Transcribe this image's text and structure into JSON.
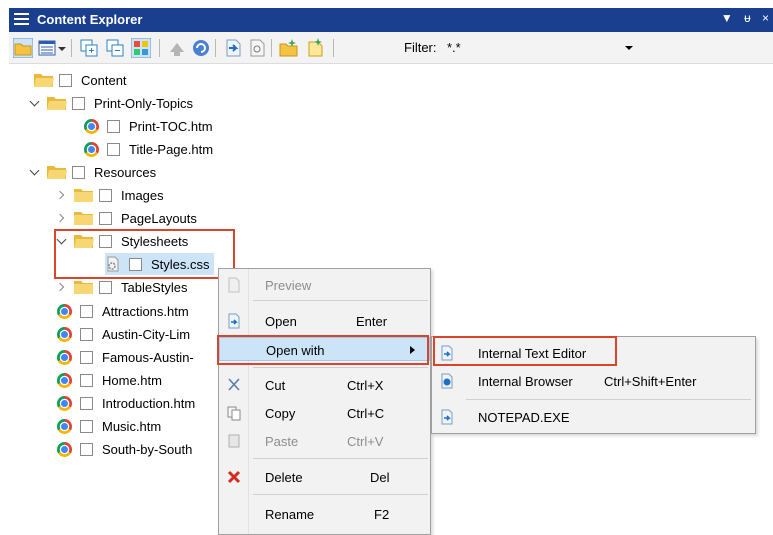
{
  "window": {
    "title": "Content Explorer",
    "title_buttons": [
      "▼",
      "ᵾ",
      "×"
    ],
    "colors": {
      "titlebar": "#1b3f8f",
      "highlight_box": "#d9442a",
      "menu_active": "#cce4f7"
    }
  },
  "toolbar": {
    "filter_label": "Filter:",
    "filter_value": "*.*"
  },
  "tree": [
    {
      "label": "Content",
      "icon": "folder-open-icon",
      "level": 0,
      "chevron": "none"
    },
    {
      "label": "Print-Only-Topics",
      "icon": "folder-open-icon",
      "level": 1,
      "chevron": "down"
    },
    {
      "label": "Print-TOC.htm",
      "icon": "chrome-icon",
      "level": 2,
      "chevron": "none"
    },
    {
      "label": "Title-Page.htm",
      "icon": "chrome-icon",
      "level": 2,
      "chevron": "none"
    },
    {
      "label": "Resources",
      "icon": "folder-open-icon",
      "level": 1,
      "chevron": "down"
    },
    {
      "label": "Images",
      "icon": "folder-icon",
      "level": 2,
      "chevron": "right"
    },
    {
      "label": "PageLayouts",
      "icon": "folder-icon",
      "level": 2,
      "chevron": "right"
    },
    {
      "label": "Stylesheets",
      "icon": "folder-open-icon",
      "level": 2,
      "chevron": "down"
    },
    {
      "label": "Styles.css",
      "icon": "css-file-icon",
      "level": 3,
      "chevron": "none"
    },
    {
      "label": "TableStyles",
      "icon": "folder-icon",
      "level": 2,
      "chevron": "right"
    },
    {
      "label": "Attractions.htm",
      "icon": "chrome-icon",
      "level": 1,
      "chevron": "none"
    },
    {
      "label": "Austin-City-Lim",
      "icon": "chrome-icon",
      "level": 1,
      "chevron": "none"
    },
    {
      "label": "Famous-Austin-",
      "icon": "chrome-icon",
      "level": 1,
      "chevron": "none"
    },
    {
      "label": "Home.htm",
      "icon": "chrome-icon",
      "level": 1,
      "chevron": "none"
    },
    {
      "label": "Introduction.htm",
      "icon": "chrome-icon",
      "level": 1,
      "chevron": "none"
    },
    {
      "label": "Music.htm",
      "icon": "chrome-icon",
      "level": 1,
      "chevron": "none"
    },
    {
      "label": "South-by-South",
      "icon": "chrome-icon",
      "level": 1,
      "chevron": "none"
    }
  ],
  "context_menu": {
    "preview": {
      "label": "Preview",
      "shortcut": ""
    },
    "open": {
      "label": "Open",
      "shortcut": "Enter"
    },
    "open_with": {
      "label": "Open with",
      "shortcut": ""
    },
    "cut": {
      "label": "Cut",
      "shortcut": "Ctrl+X"
    },
    "copy": {
      "label": "Copy",
      "shortcut": "Ctrl+C"
    },
    "paste": {
      "label": "Paste",
      "shortcut": "Ctrl+V"
    },
    "delete": {
      "label": "Delete",
      "shortcut": "Del"
    },
    "rename": {
      "label": "Rename",
      "shortcut": "F2"
    }
  },
  "submenu": {
    "internal_text_editor": {
      "label": "Internal Text Editor",
      "shortcut": ""
    },
    "internal_browser": {
      "label": "Internal Browser",
      "shortcut": "Ctrl+Shift+Enter"
    },
    "notepad": {
      "label": "NOTEPAD.EXE",
      "shortcut": ""
    }
  }
}
